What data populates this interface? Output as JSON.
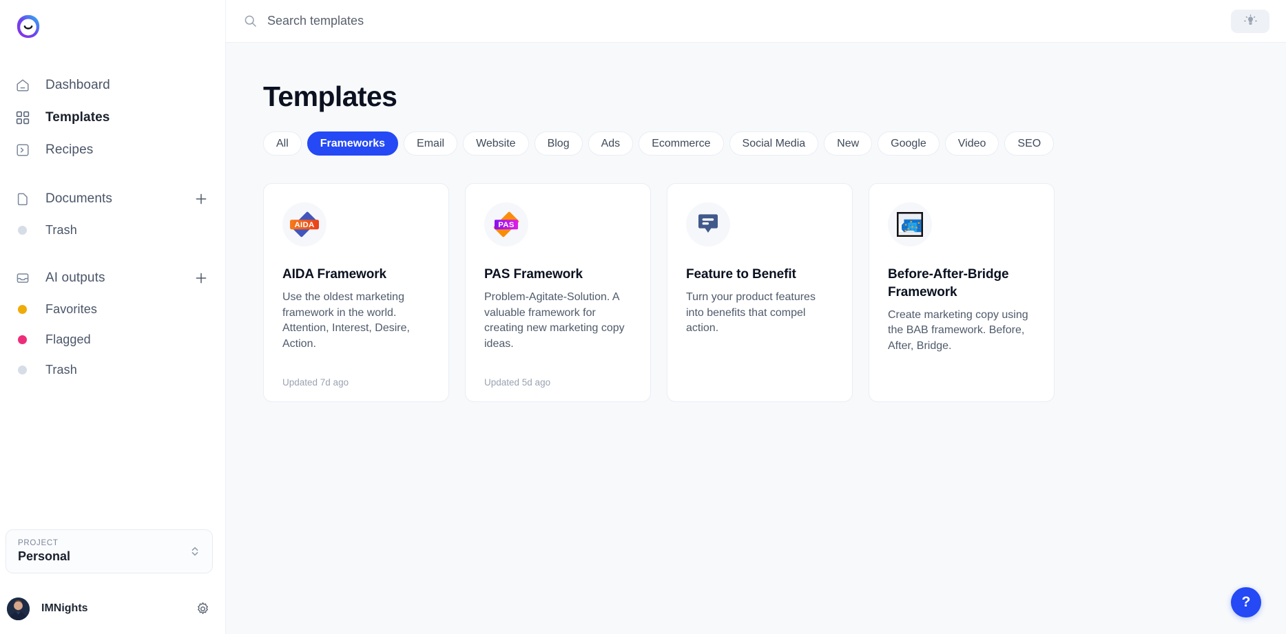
{
  "brand": {
    "logo_icon": "smiley-ring-logo"
  },
  "search": {
    "placeholder": "Search templates",
    "value": "",
    "icon": "search-icon"
  },
  "topbar": {
    "theme_toggle_icon": "lightbulb-icon"
  },
  "sidebar": {
    "nav": [
      {
        "label": "Dashboard",
        "icon": "home-icon",
        "active": false
      },
      {
        "label": "Templates",
        "icon": "grid-icon",
        "active": true
      },
      {
        "label": "Recipes",
        "icon": "terminal-icon",
        "active": false
      }
    ],
    "documents": {
      "label": "Documents",
      "icon": "file-icon",
      "add_icon": "plus-icon",
      "children": [
        {
          "label": "Trash",
          "dot_color": "#d7dde6"
        }
      ]
    },
    "ai_outputs": {
      "label": "AI outputs",
      "icon": "inbox-icon",
      "add_icon": "plus-icon",
      "children": [
        {
          "label": "Favorites",
          "dot_color": "#efab07"
        },
        {
          "label": "Flagged",
          "dot_color": "#ec2e7a"
        },
        {
          "label": "Trash",
          "dot_color": "#d7dde6"
        }
      ]
    },
    "project": {
      "label": "PROJECT",
      "value": "Personal",
      "chevron_icon": "chevron-up-down-icon"
    },
    "user": {
      "name": "IMNights",
      "avatar_icon": "user-avatar",
      "settings_icon": "gear-icon"
    }
  },
  "main": {
    "title": "Templates",
    "filters": [
      {
        "label": "All",
        "active": false
      },
      {
        "label": "Frameworks",
        "active": true
      },
      {
        "label": "Email",
        "active": false
      },
      {
        "label": "Website",
        "active": false
      },
      {
        "label": "Blog",
        "active": false
      },
      {
        "label": "Ads",
        "active": false
      },
      {
        "label": "Ecommerce",
        "active": false
      },
      {
        "label": "Social Media",
        "active": false
      },
      {
        "label": "New",
        "active": false
      },
      {
        "label": "Google",
        "active": false
      },
      {
        "label": "Video",
        "active": false
      },
      {
        "label": "SEO",
        "active": false
      }
    ],
    "cards": [
      {
        "icon": "aida-badge-icon",
        "icon_text": "AIDA",
        "title": "AIDA Framework",
        "description": "Use the oldest marketing framework in the world. Attention, Interest, Desire, Action.",
        "updated": "Updated 7d ago"
      },
      {
        "icon": "pas-badge-icon",
        "icon_text": "PAS",
        "title": "PAS Framework",
        "description": "Problem-Agitate-Solution. A valuable framework for creating new marketing copy ideas.",
        "updated": "Updated 5d ago"
      },
      {
        "icon": "speech-bubble-icon",
        "icon_text": "",
        "title": "Feature to Benefit",
        "description": "Turn your product features into benefits that compel action.",
        "updated": ""
      },
      {
        "icon": "city-bridge-pixel-icon",
        "icon_text": "",
        "title": "Before-After-Bridge Framework",
        "description": "Create marketing copy using the BAB framework. Before, After, Bridge.",
        "updated": ""
      }
    ],
    "help_button_label": "?"
  },
  "colors": {
    "accent_blue": "#2449f5",
    "page_bg": "#f7f9fb",
    "card_bg": "#ffffff",
    "favorites_dot": "#efab07",
    "flagged_dot": "#ec2e7a",
    "trash_dot": "#d7dde6"
  }
}
